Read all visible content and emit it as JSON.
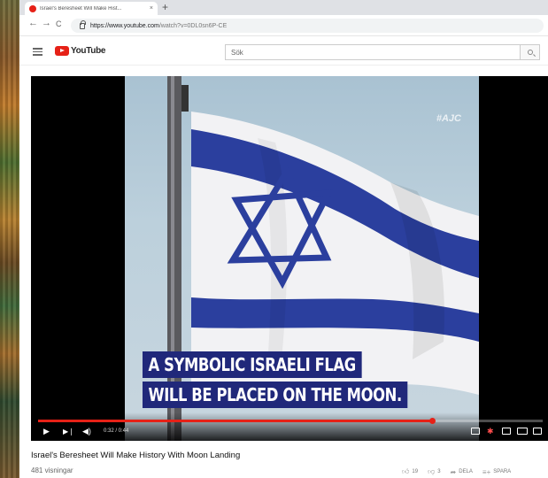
{
  "tab": {
    "title": "Israel's Beresheet Will Make Hist...",
    "close": "×",
    "new_tab": "+"
  },
  "nav": {
    "back": "←",
    "forward": "→",
    "reload": "C"
  },
  "address": {
    "host": "https://www.youtube.com",
    "path": "/watch?v=0DL0sn6P-CE"
  },
  "youtube": {
    "logo_text": "YouTube",
    "search_placeholder": "Sök"
  },
  "video": {
    "watermark": "#AJC",
    "caption_line1": "A SYMBOLIC ISRAELI FLAG",
    "caption_line2": "WILL BE PLACED ON THE MOON.",
    "time": "0:32 / 0:44",
    "progress": 0.78
  },
  "info": {
    "title": "Israel's Beresheet Will Make History With Moon Landing",
    "views": "481 visningar",
    "likes": "19",
    "dislikes": "3",
    "share": "DELA",
    "save": "SPARA"
  },
  "colors": {
    "youtube_red": "#e62117",
    "flag_blue": "#2b3f9e",
    "caption_bg": "#20287a"
  }
}
